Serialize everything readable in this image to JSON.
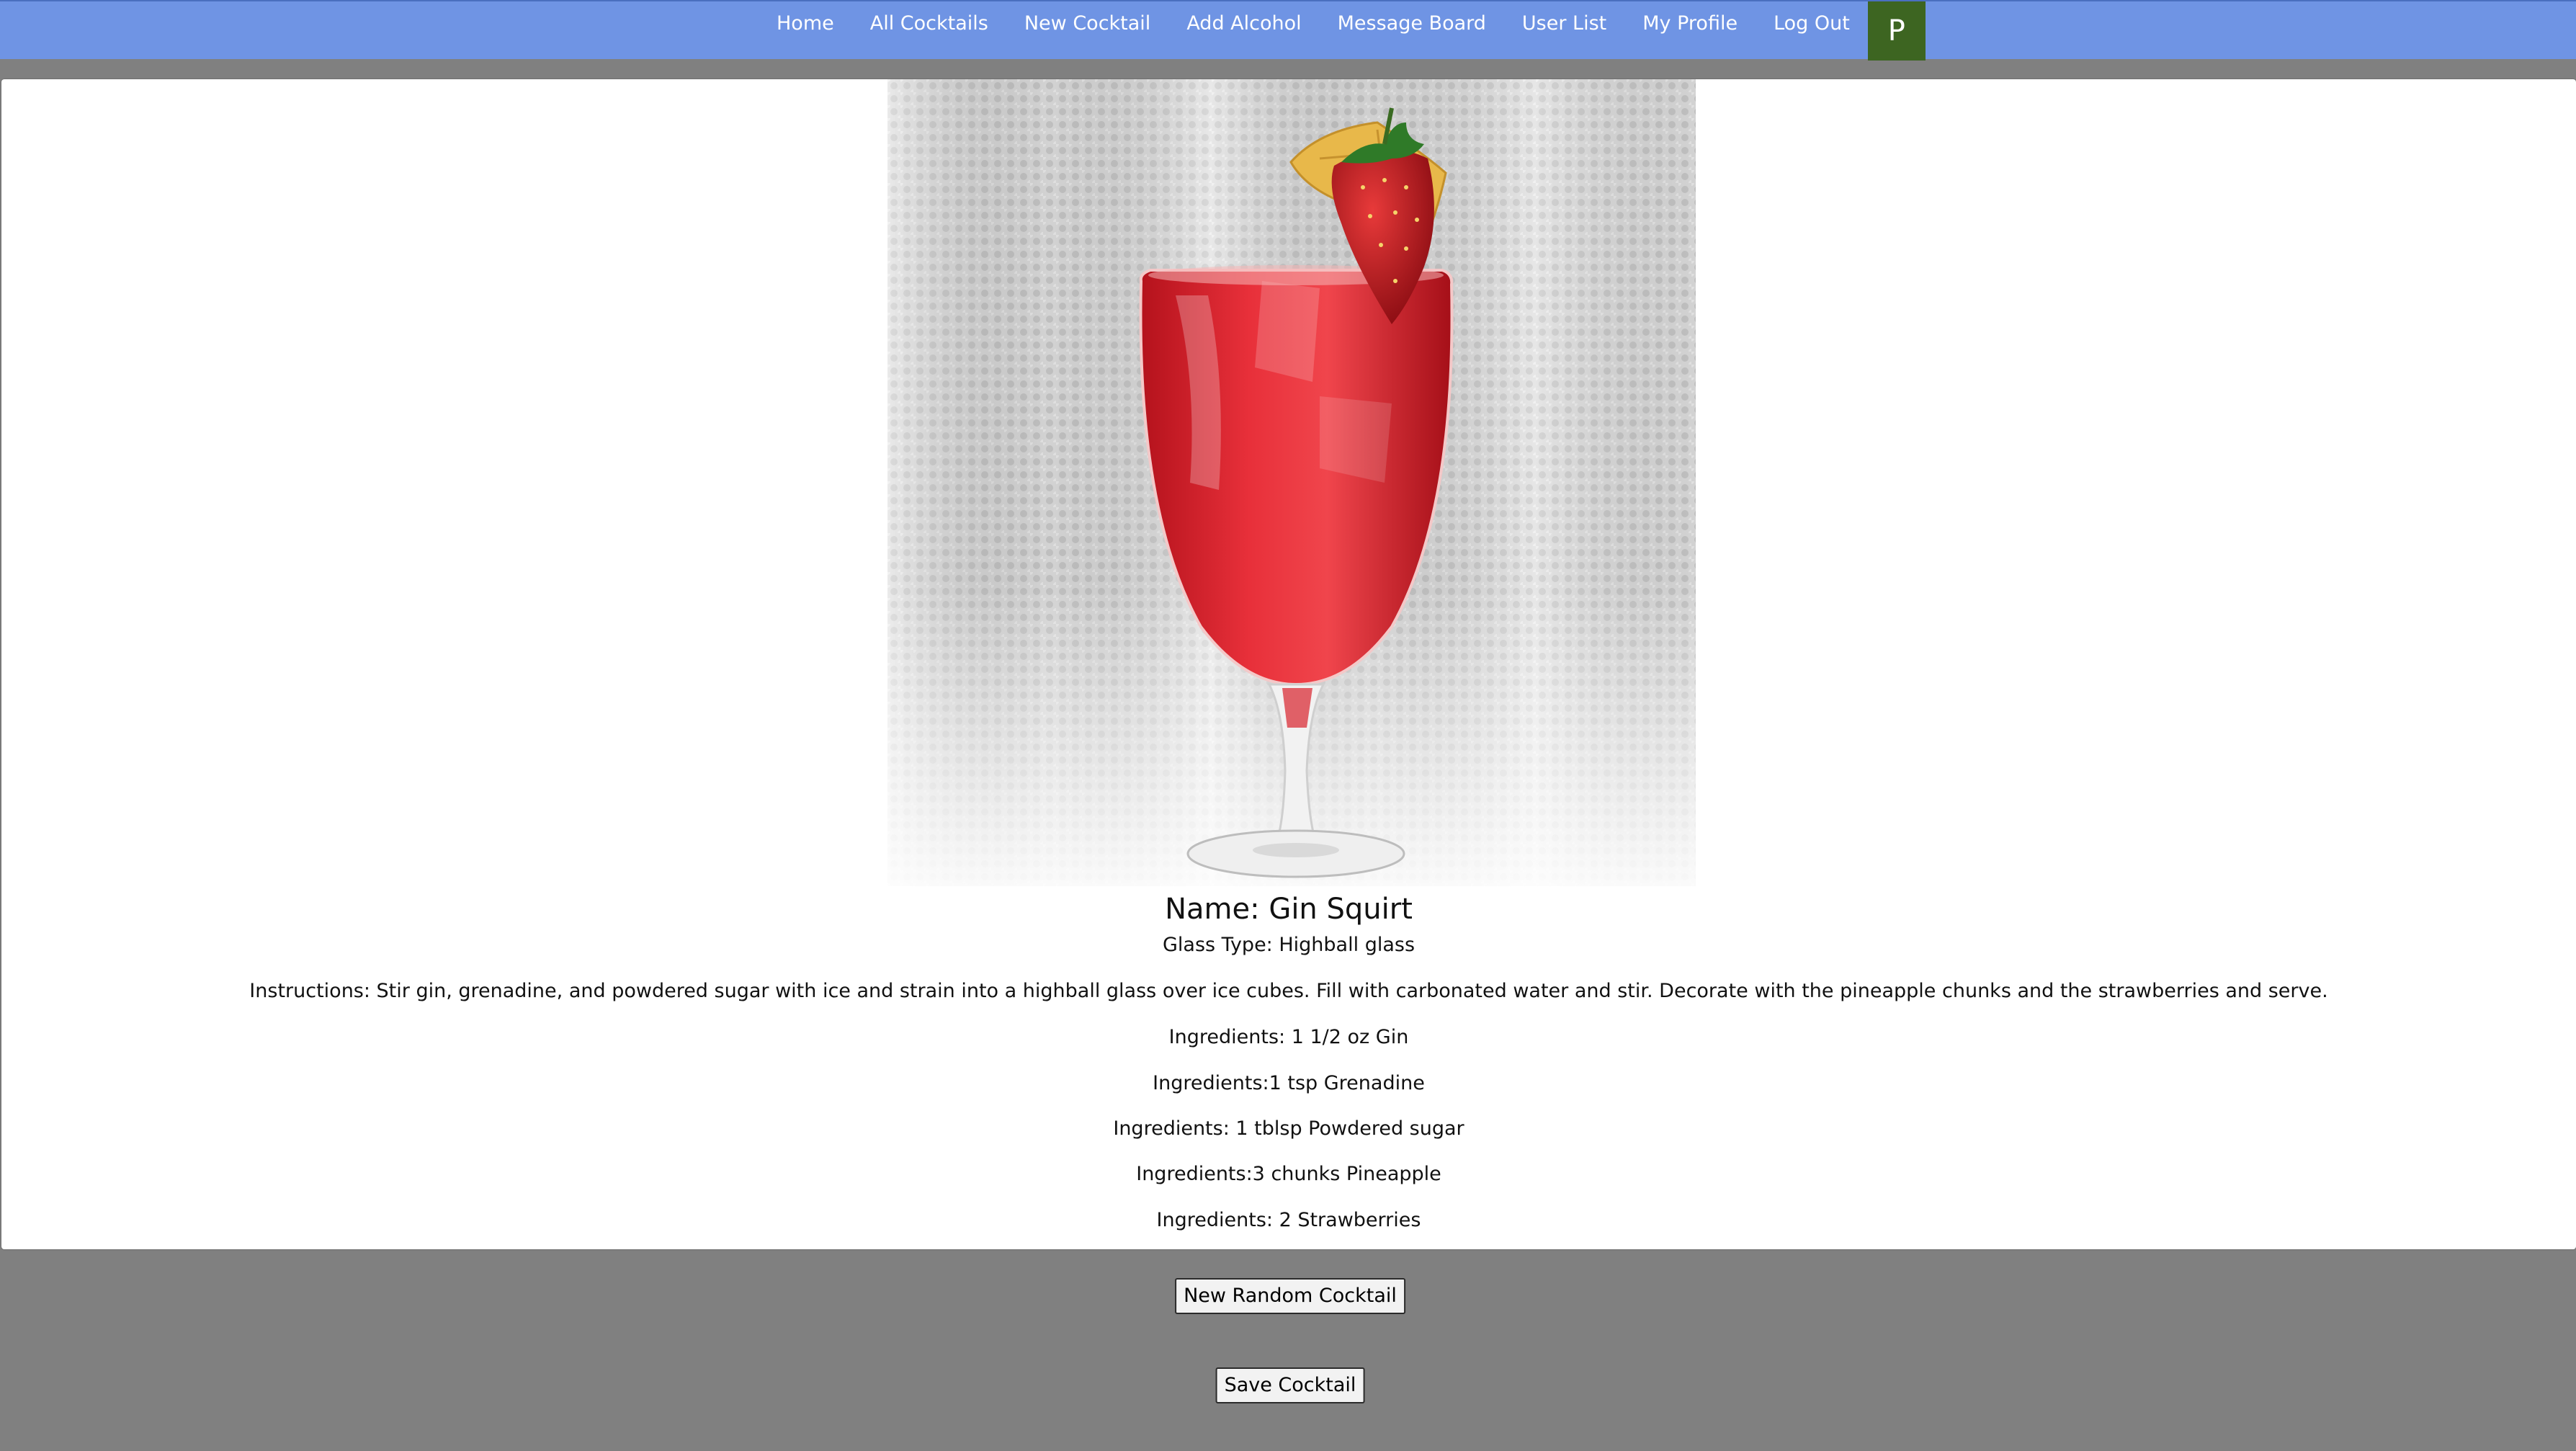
{
  "nav": {
    "links": [
      "Home",
      "All Cocktails",
      "New Cocktail",
      "Add Alcohol",
      "Message Board",
      "User List",
      "My Profile",
      "Log Out"
    ],
    "avatar_letter": "P",
    "avatar_color": "#3d6521",
    "bar_color": "#6f94e4"
  },
  "cocktail": {
    "name": "Name: Gin Squirt",
    "glass": "Glass Type: Highball glass",
    "instructions": "Instructions: Stir gin, grenadine, and powdered sugar with ice and strain into a highball glass over ice cubes. Fill with carbonated water and stir. Decorate with the pineapple chunks and the strawberries and serve.",
    "ingredients": [
      "Ingredients: 1 1/2 oz Gin",
      "Ingredients:1 tsp Grenadine",
      "Ingredients: 1 tblsp Powdered sugar",
      "Ingredients:3 chunks Pineapple",
      "Ingredients: 2 Strawberries"
    ]
  },
  "buttons": {
    "random_label": "New Random Cocktail",
    "save_label": "Save Cocktail"
  }
}
